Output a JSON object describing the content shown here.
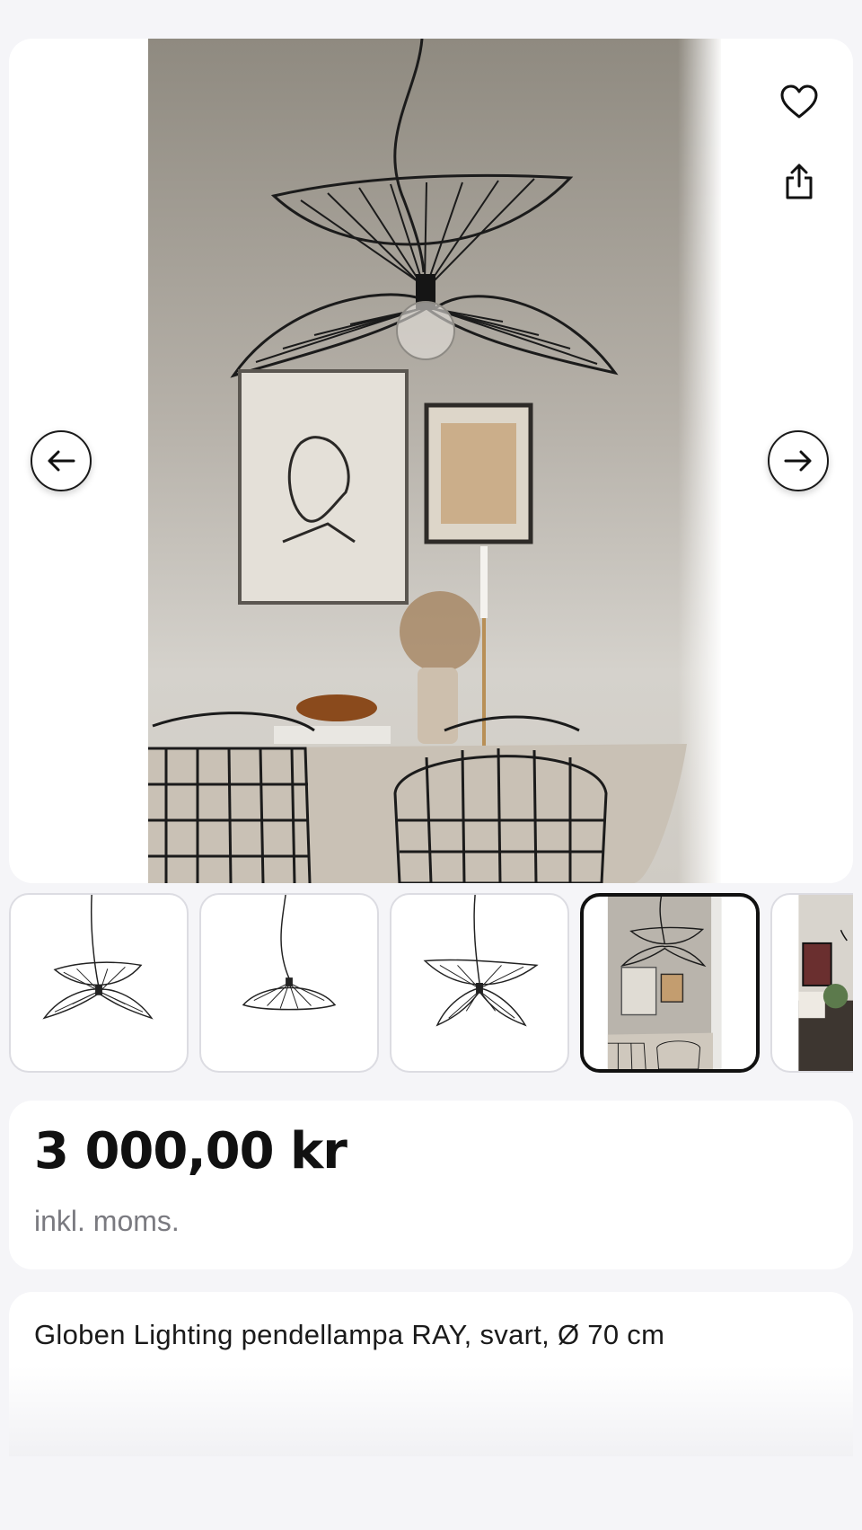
{
  "gallery": {
    "main_image_alt": "Globen Lighting RAY pendant lamp above a dining table",
    "favorite_icon": "heart-outline-icon",
    "share_icon": "share-icon",
    "prev_icon": "arrow-left-icon",
    "next_icon": "arrow-right-icon",
    "thumbnails": [
      {
        "alt": "Pendant lamp, double shade, side view"
      },
      {
        "alt": "Pendant lamp, single shade"
      },
      {
        "alt": "Pendant lamp, double shade, open"
      },
      {
        "alt": "Lamp in dining room interior",
        "active": true
      },
      {
        "alt": "Lamp in living room interior"
      }
    ]
  },
  "pricing": {
    "price": "3 000,00 kr",
    "note": "inkl. moms."
  },
  "product": {
    "title": "Globen Lighting pendellampa RAY, svart, Ø 70 cm"
  },
  "colors": {
    "background": "#f5f5f8",
    "card": "#ffffff",
    "text": "#1a1a1a",
    "muted": "#7a7a80",
    "active_border": "#111111"
  }
}
